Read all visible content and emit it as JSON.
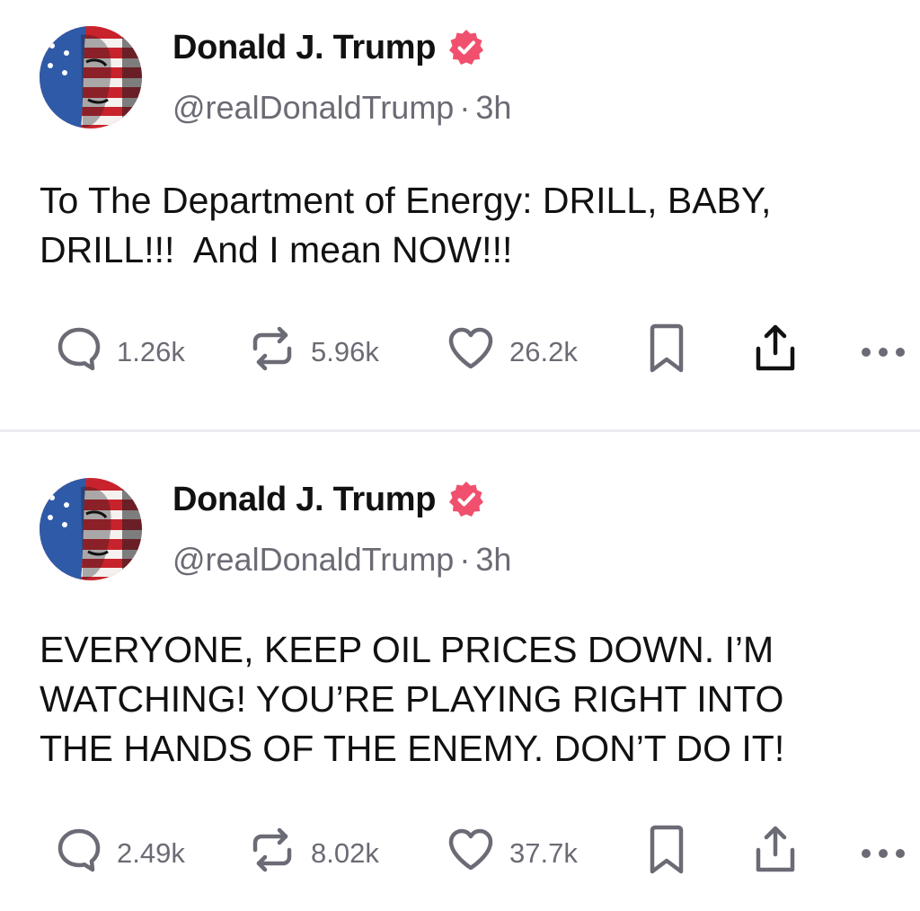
{
  "posts": [
    {
      "display_name": "Donald J. Trump",
      "handle": "@realDonaldTrump",
      "separator": "·",
      "time": "3h",
      "text": "To The Department of Energy: DRILL, BABY,\nDRILL!!!  And I mean NOW!!!",
      "replies": "1.26k",
      "reposts": "5.96k",
      "likes": "26.2k"
    },
    {
      "display_name": "Donald J. Trump",
      "handle": "@realDonaldTrump",
      "separator": "·",
      "time": "3h",
      "text": "EVERYONE, KEEP OIL PRICES DOWN. I’M\nWATCHING! YOU’RE PLAYING RIGHT INTO\nTHE HANDS OF THE ENEMY. DON’T DO IT!",
      "replies": "2.49k",
      "reposts": "8.02k",
      "likes": "37.7k"
    }
  ],
  "icons": {
    "verified": "verified-badge-icon",
    "reply": "reply-bubble-icon",
    "repost": "repost-arrows-icon",
    "like": "heart-icon",
    "bookmark": "bookmark-icon",
    "share": "share-upload-icon",
    "more": "more-dots-icon"
  },
  "colors": {
    "verified": "#f0506e",
    "action_gray": "#6b6b75",
    "text": "#111111",
    "divider": "#ececf0"
  }
}
